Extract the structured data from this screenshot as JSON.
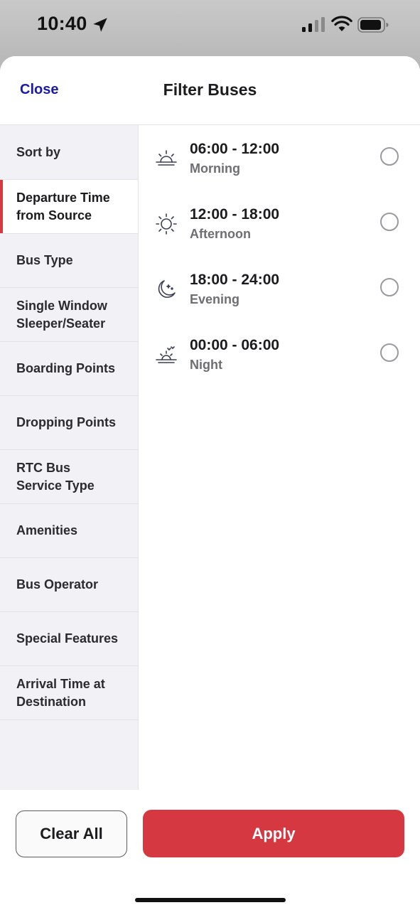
{
  "status_bar": {
    "time": "10:40",
    "icons": [
      "location-arrow-icon",
      "cellular-signal-icon",
      "wifi-icon",
      "battery-icon"
    ]
  },
  "header": {
    "close_label": "Close",
    "title": "Filter Buses"
  },
  "sidebar": {
    "items": [
      {
        "label": "Sort by",
        "active": false
      },
      {
        "label": "Departure Time\nfrom Source",
        "active": true
      },
      {
        "label": "Bus Type",
        "active": false
      },
      {
        "label": "Single Window\nSleeper/Seater",
        "active": false
      },
      {
        "label": "Boarding Points",
        "active": false
      },
      {
        "label": "Dropping Points",
        "active": false
      },
      {
        "label": "RTC Bus\nService Type",
        "active": false
      },
      {
        "label": "Amenities",
        "active": false
      },
      {
        "label": "Bus Operator",
        "active": false
      },
      {
        "label": "Special Features",
        "active": false
      },
      {
        "label": "Arrival Time at\nDestination",
        "active": false
      }
    ]
  },
  "options": [
    {
      "range": "06:00 - 12:00",
      "label": "Morning",
      "icon": "sunrise-icon",
      "selected": false
    },
    {
      "range": "12:00 - 18:00",
      "label": "Afternoon",
      "icon": "sun-icon",
      "selected": false
    },
    {
      "range": "18:00 - 24:00",
      "label": "Evening",
      "icon": "moon-icon",
      "selected": false
    },
    {
      "range": "00:00 - 06:00",
      "label": "Night",
      "icon": "night-sunset-icon",
      "selected": false
    }
  ],
  "footer": {
    "clear_label": "Clear All",
    "apply_label": "Apply"
  },
  "colors": {
    "accent": "#d63841",
    "close_link": "#1a1aa8",
    "sidebar_bg": "#f1f1f6"
  }
}
